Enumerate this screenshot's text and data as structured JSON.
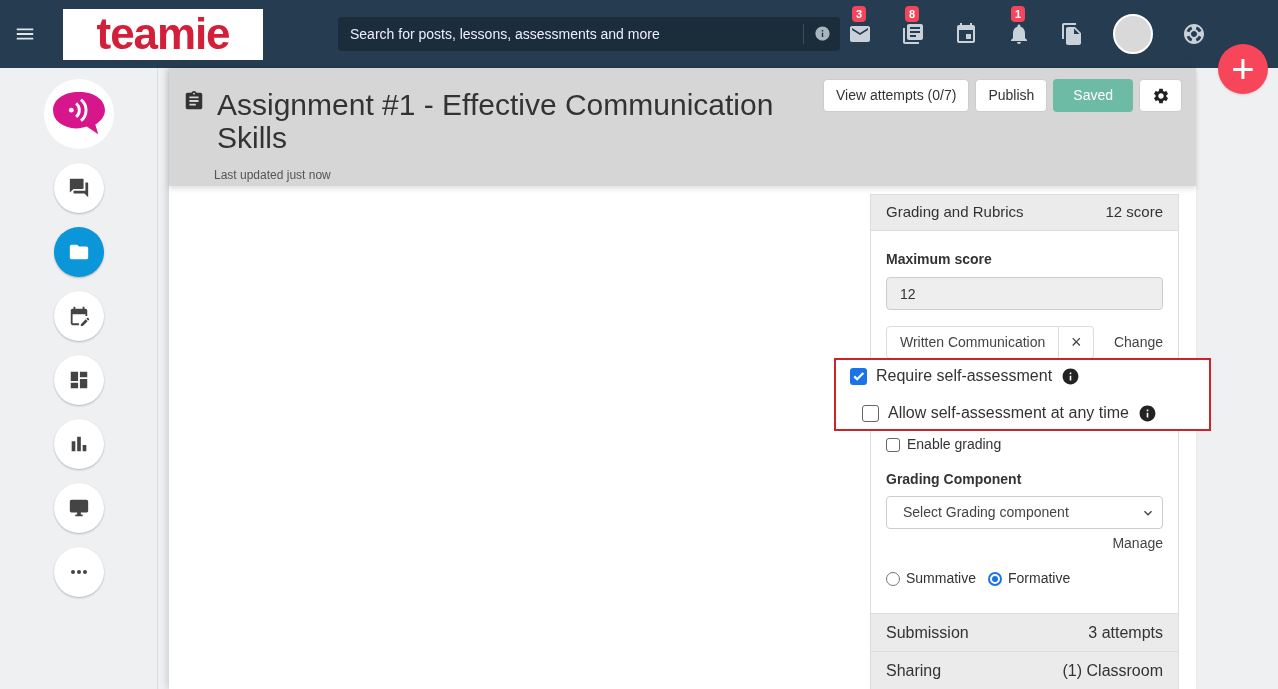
{
  "topbar": {
    "logo": "teamie",
    "search": {
      "placeholder": "Search for posts, lessons, assessments and more"
    },
    "icons": [
      {
        "kind": "mail",
        "badge": "3"
      },
      {
        "kind": "posts",
        "badge": "8"
      },
      {
        "kind": "calendar"
      },
      {
        "kind": "bell",
        "badge": "1"
      },
      {
        "kind": "files"
      },
      {
        "kind": "avatar"
      },
      {
        "kind": "help"
      }
    ]
  },
  "sidebar": {
    "items": [
      {
        "kind": "chat",
        "selected": false
      },
      {
        "kind": "folder",
        "selected": true
      },
      {
        "kind": "schedule",
        "selected": false
      },
      {
        "kind": "dashboard",
        "selected": false
      },
      {
        "kind": "chart",
        "selected": false
      },
      {
        "kind": "monitor",
        "selected": false
      },
      {
        "kind": "more",
        "selected": false
      }
    ]
  },
  "header": {
    "title": "Assignment #1 - Effective Communication Skills",
    "subtitle": "Last updated just now",
    "buttons": [
      {
        "kind": "plain",
        "label": "View attempts (0/7)"
      },
      {
        "kind": "plain",
        "label": "Publish"
      },
      {
        "kind": "saved",
        "label": "Saved"
      },
      {
        "kind": "settings"
      }
    ]
  },
  "panel": {
    "section": {
      "title": "Grading and Rubrics",
      "value": "12 score"
    },
    "max_score": {
      "label": "Maximum score",
      "value": "12"
    },
    "rubric": {
      "name": "Written Communication",
      "remove": "×",
      "change": "Change"
    },
    "highlighted_options": [
      {
        "label": "Require self-assessment",
        "checked": true
      },
      {
        "label": "Allow self-assessment at any time",
        "checked": false
      }
    ],
    "enable_grading": {
      "label": "Enable grading",
      "checked": false
    },
    "grading_component": {
      "label": "Grading Component",
      "placeholder": "Select Grading component",
      "manage": "Manage"
    },
    "types": [
      {
        "label": "Summative",
        "selected": false
      },
      {
        "label": "Formative",
        "selected": true
      }
    ],
    "sections": [
      {
        "title": "Submission",
        "value": "3 attempts"
      },
      {
        "title": "Sharing",
        "value": "(1) Classroom"
      }
    ]
  },
  "fab": "+"
}
